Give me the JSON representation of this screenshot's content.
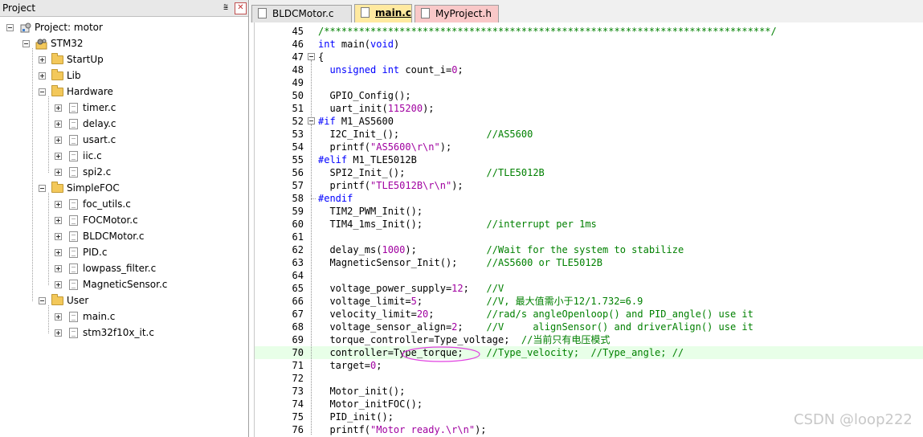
{
  "project_panel": {
    "title": "Project",
    "pin_label": "ᵖ",
    "close_label": "✕",
    "root": "Project: motor",
    "target": "STM32",
    "groups": [
      {
        "name": "StartUp",
        "expanded": false,
        "files": []
      },
      {
        "name": "Lib",
        "expanded": false,
        "files": []
      },
      {
        "name": "Hardware",
        "expanded": true,
        "files": [
          "timer.c",
          "delay.c",
          "usart.c",
          "iic.c",
          "spi2.c"
        ]
      },
      {
        "name": "SimpleFOC",
        "expanded": true,
        "files": [
          "foc_utils.c",
          "FOCMotor.c",
          "BLDCMotor.c",
          "PID.c",
          "lowpass_filter.c",
          "MagneticSensor.c"
        ]
      },
      {
        "name": "User",
        "expanded": true,
        "files": [
          "main.c",
          "stm32f10x_it.c"
        ]
      }
    ]
  },
  "tabs": [
    {
      "label": "BLDCMotor.c",
      "active": false,
      "color": "#e4e4e4"
    },
    {
      "label": "main.c",
      "active": true,
      "color": "#ffe9a0"
    },
    {
      "label": "MyProject.h",
      "active": false,
      "color": "#f9c8c8"
    }
  ],
  "editor": {
    "lines": [
      {
        "n": "45",
        "text": "/*****************************************************************************/"
      },
      {
        "n": "46",
        "text": "int main(void)"
      },
      {
        "n": "47",
        "text": "{"
      },
      {
        "n": "48",
        "text": "  unsigned int count_i=0;"
      },
      {
        "n": "49",
        "text": ""
      },
      {
        "n": "50",
        "text": "  GPIO_Config();"
      },
      {
        "n": "51",
        "text": "  uart_init(115200);"
      },
      {
        "n": "52",
        "text": "#if M1_AS5600"
      },
      {
        "n": "53",
        "text": "  I2C_Init_();               //AS5600"
      },
      {
        "n": "54",
        "text": "  printf(\"AS5600\\r\\n\");"
      },
      {
        "n": "55",
        "text": "#elif M1_TLE5012B"
      },
      {
        "n": "56",
        "text": "  SPI2_Init_();              //TLE5012B"
      },
      {
        "n": "57",
        "text": "  printf(\"TLE5012B\\r\\n\");"
      },
      {
        "n": "58",
        "text": "#endif"
      },
      {
        "n": "59",
        "text": "  TIM2_PWM_Init();"
      },
      {
        "n": "60",
        "text": "  TIM4_1ms_Init();           //interrupt per 1ms"
      },
      {
        "n": "61",
        "text": ""
      },
      {
        "n": "62",
        "text": "  delay_ms(1000);            //Wait for the system to stabilize"
      },
      {
        "n": "63",
        "text": "  MagneticSensor_Init();     //AS5600 or TLE5012B"
      },
      {
        "n": "64",
        "text": ""
      },
      {
        "n": "65",
        "text": "  voltage_power_supply=12;   //V"
      },
      {
        "n": "66",
        "text": "  voltage_limit=5;           //V, 最大值需小于12/1.732=6.9"
      },
      {
        "n": "67",
        "text": "  velocity_limit=20;         //rad/s angleOpenloop() and PID_angle() use it"
      },
      {
        "n": "68",
        "text": "  voltage_sensor_align=2;    //V     alignSensor() and driverAlign() use it"
      },
      {
        "n": "69",
        "text": "  torque_controller=Type_voltage;  //当前只有电压模式"
      },
      {
        "n": "70",
        "text": "  controller=Type_torque;    //Type_velocity;  //Type_angle; //"
      },
      {
        "n": "71",
        "text": "  target=0;"
      },
      {
        "n": "72",
        "text": ""
      },
      {
        "n": "73",
        "text": "  Motor_init();"
      },
      {
        "n": "74",
        "text": "  Motor_initFOC();"
      },
      {
        "n": "75",
        "text": "  PID_init();"
      },
      {
        "n": "76",
        "text": "  printf(\"Motor ready.\\r\\n\");"
      }
    ],
    "current_line": "70",
    "annotation": "ellipse around Type_torque"
  },
  "watermark": "CSDN @loop222"
}
